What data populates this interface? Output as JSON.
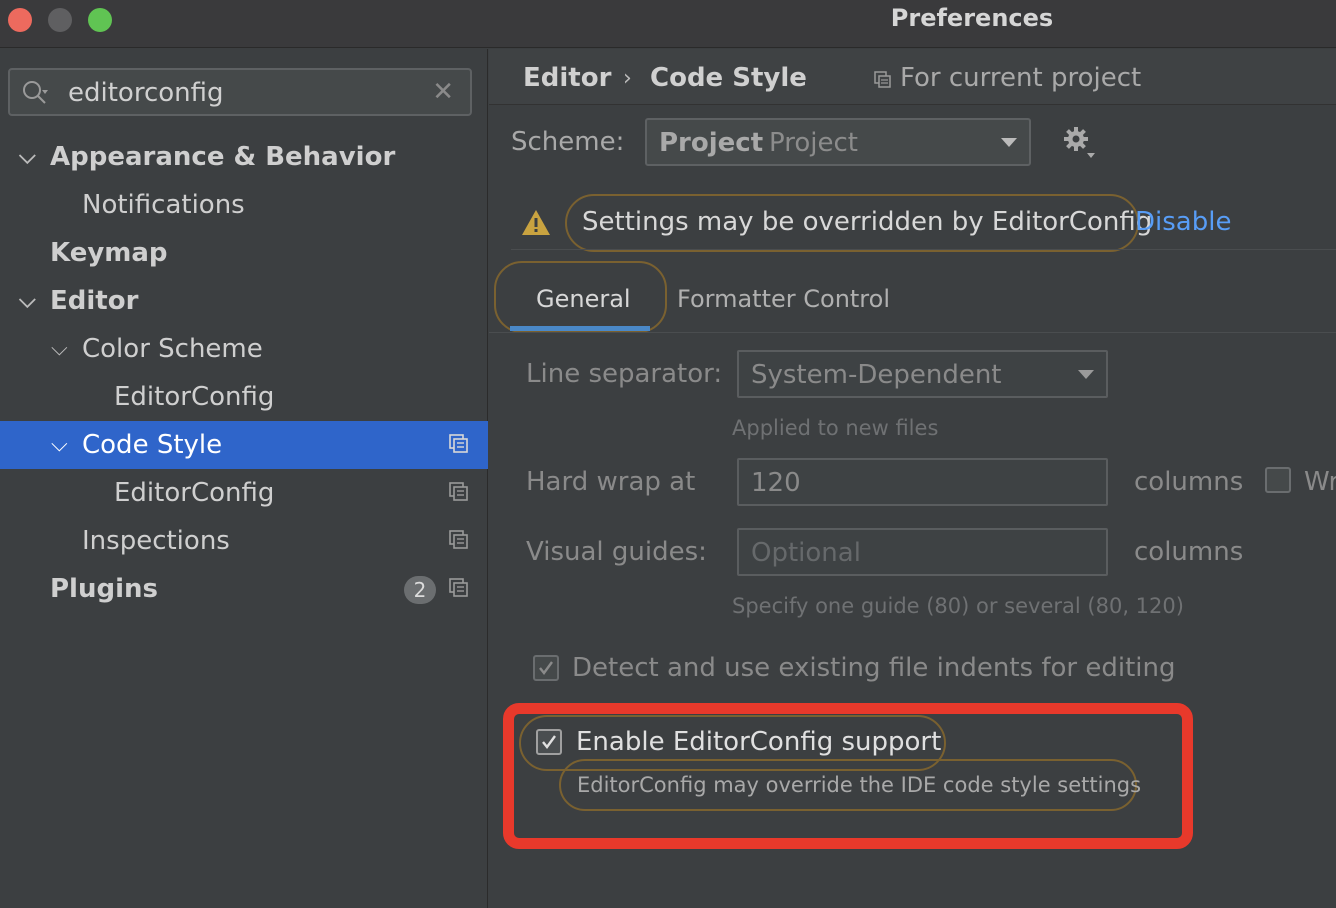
{
  "window": {
    "title": "Preferences"
  },
  "search": {
    "value": "editorconfig"
  },
  "tree": {
    "appearance": "Appearance & Behavior",
    "notifications": "Notifications",
    "keymap": "Keymap",
    "editor": "Editor",
    "color_scheme": "Color Scheme",
    "color_scheme_editorconfig": "EditorConfig",
    "code_style": "Code Style",
    "code_style_editorconfig": "EditorConfig",
    "inspections": "Inspections",
    "plugins": "Plugins",
    "plugins_badge": "2"
  },
  "breadcrumb": {
    "editor": "Editor",
    "separator": "›",
    "code_style": "Code Style",
    "scope": "For current project"
  },
  "scheme": {
    "label": "Scheme:",
    "value_bold": "Project",
    "value_sub": "Project"
  },
  "warning": {
    "text": "Settings may be overridden by EditorConfig",
    "link": "Disable"
  },
  "tabs": {
    "general": "General",
    "formatter": "Formatter Control"
  },
  "general": {
    "line_separator_label": "Line separator:",
    "line_separator_value": "System-Dependent",
    "line_separator_hint": "Applied to new files",
    "hard_wrap_label": "Hard wrap at",
    "hard_wrap_value": "120",
    "hard_wrap_unit": "columns",
    "wrap_cutoff": "Wr",
    "visual_guides_label": "Visual guides:",
    "visual_guides_placeholder": "Optional",
    "visual_guides_unit": "columns",
    "visual_guides_hint": "Specify one guide (80) or several (80, 120)",
    "detect_indents_label": "Detect and use existing file indents for editing",
    "editorconfig_label": "Enable EditorConfig support",
    "editorconfig_desc": "EditorConfig may override the IDE code style settings"
  },
  "colors": {
    "accent_selection": "#2f65ca",
    "link": "#589df6",
    "highlight_outline": "#7a6130",
    "callout_red": "#e8392b"
  }
}
